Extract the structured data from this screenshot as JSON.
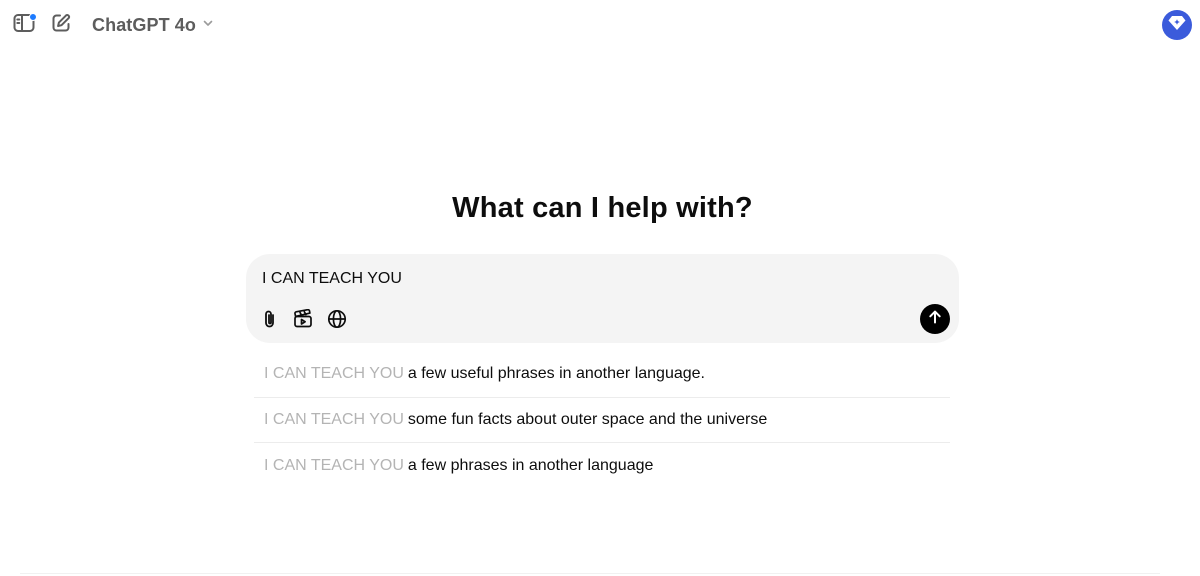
{
  "header": {
    "model_name": "ChatGPT 4o",
    "icons": {
      "sidebar": "sidebar-toggle-icon",
      "new_chat": "new-chat-icon",
      "model_chevron": "chevron-down-icon",
      "avatar": "upgrade-diamond-icon"
    },
    "notification_dot": true
  },
  "main": {
    "headline": "What can I help with?"
  },
  "composer": {
    "value": "I CAN TEACH YOU",
    "tools": [
      "attach-icon",
      "video-clapper-icon",
      "globe-icon"
    ],
    "send_icon": "arrow-up-icon"
  },
  "suggestions": [
    {
      "prefix": "I CAN TEACH YOU",
      "rest": "a few useful phrases in another language."
    },
    {
      "prefix": "I CAN TEACH YOU",
      "rest": "some fun facts about outer space and the universe"
    },
    {
      "prefix": "I CAN TEACH YOU",
      "rest": "a few phrases in another language"
    }
  ],
  "colors": {
    "accent": "#3b5bdb",
    "dot": "#1d7bff",
    "composer_bg": "#f4f4f4",
    "suggestion_prefix": "#b4b4b4"
  }
}
